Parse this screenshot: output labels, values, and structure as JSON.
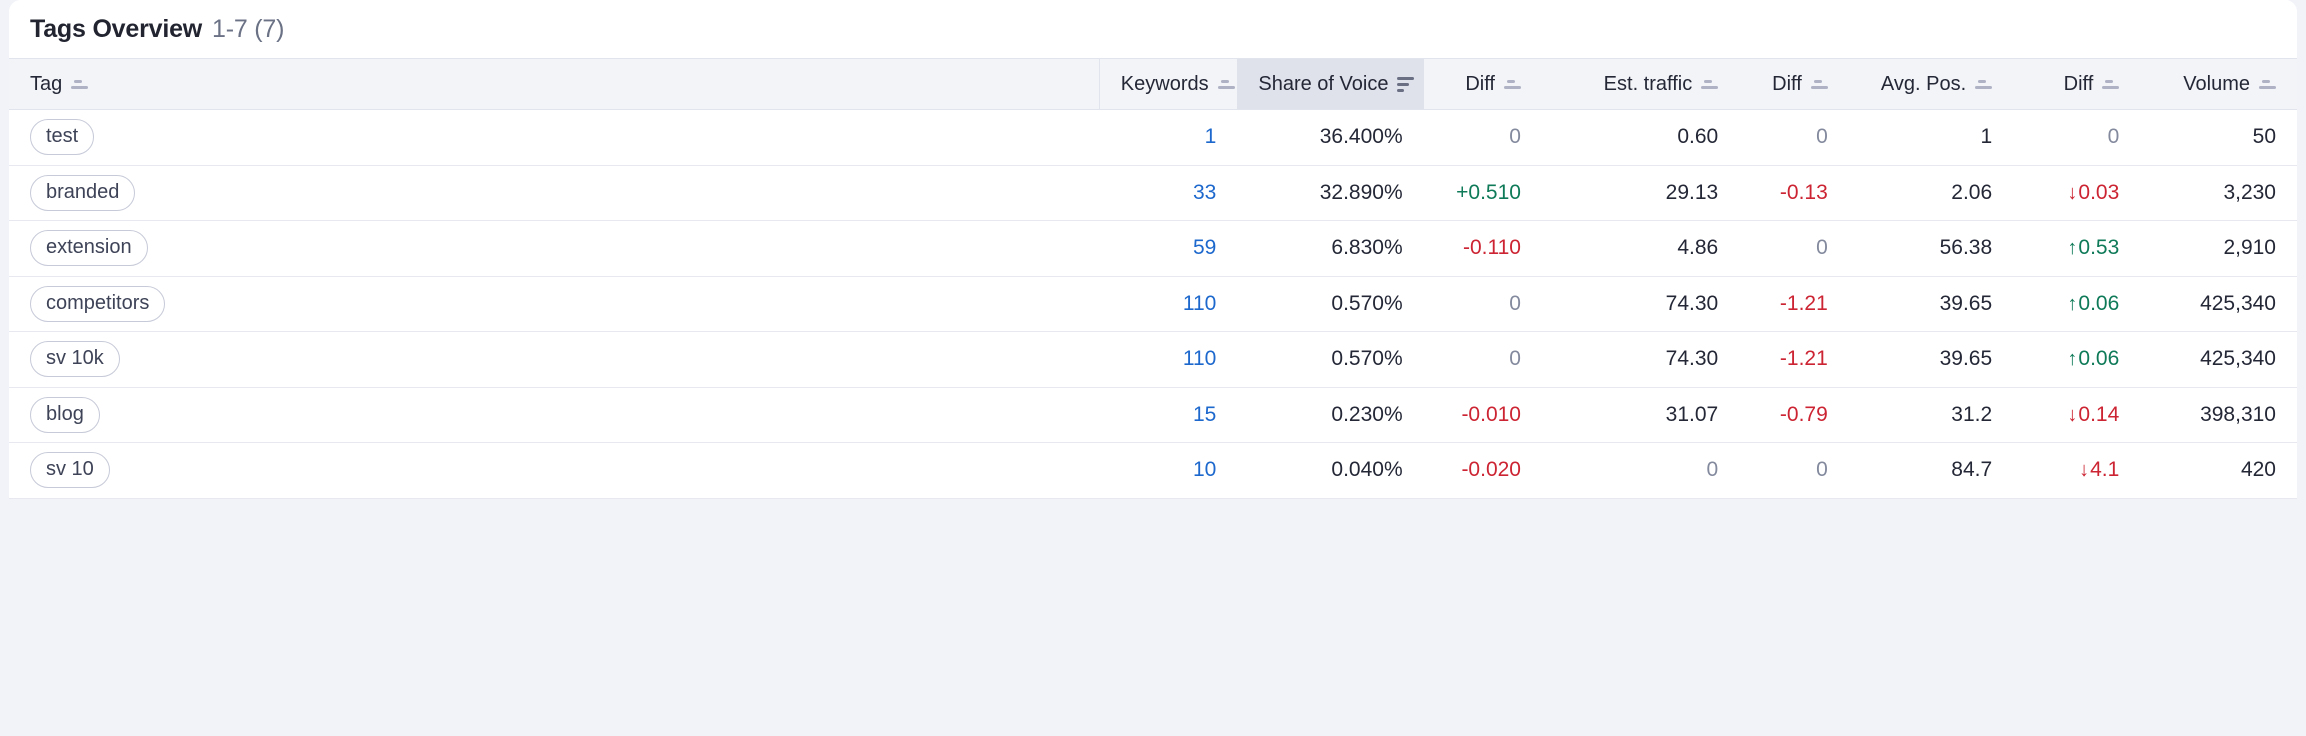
{
  "card": {
    "title": "Tags Overview",
    "count": "1-7 (7)"
  },
  "table": {
    "columns": [
      {
        "label": "Tag",
        "sort": "inactive"
      },
      {
        "label": "Keywords",
        "sort": "inactive"
      },
      {
        "label": "Share of Voice",
        "sort": "active"
      },
      {
        "label": "Diff",
        "sort": "inactive"
      },
      {
        "label": "Est. traffic",
        "sort": "inactive"
      },
      {
        "label": "Diff",
        "sort": "inactive"
      },
      {
        "label": "Avg. Pos.",
        "sort": "inactive"
      },
      {
        "label": "Diff",
        "sort": "inactive"
      },
      {
        "label": "Volume",
        "sort": "inactive"
      }
    ],
    "rows": [
      {
        "tag": "test",
        "keywords": "1",
        "share_of_voice": "36.400%",
        "sov_diff": "0",
        "sov_diff_state": "zero",
        "est_traffic": "0.60",
        "est_traffic_state": "plain",
        "traffic_diff": "0",
        "traffic_diff_state": "zero",
        "avg_pos": "1",
        "avg_pos_state": "plain",
        "pos_diff": "0",
        "pos_diff_state": "zero",
        "pos_diff_arrow": "",
        "volume": "50"
      },
      {
        "tag": "branded",
        "keywords": "33",
        "share_of_voice": "32.890%",
        "sov_diff": "+0.510",
        "sov_diff_state": "pos",
        "est_traffic": "29.13",
        "est_traffic_state": "plain",
        "traffic_diff": "-0.13",
        "traffic_diff_state": "neg",
        "avg_pos": "2.06",
        "avg_pos_state": "plain",
        "pos_diff": "0.03",
        "pos_diff_state": "neg",
        "pos_diff_arrow": "↓",
        "volume": "3,230"
      },
      {
        "tag": "extension",
        "keywords": "59",
        "share_of_voice": "6.830%",
        "sov_diff": "-0.110",
        "sov_diff_state": "neg",
        "est_traffic": "4.86",
        "est_traffic_state": "plain",
        "traffic_diff": "0",
        "traffic_diff_state": "zero",
        "avg_pos": "56.38",
        "avg_pos_state": "plain",
        "pos_diff": "0.53",
        "pos_diff_state": "pos",
        "pos_diff_arrow": "↑",
        "volume": "2,910"
      },
      {
        "tag": "competitors",
        "keywords": "110",
        "share_of_voice": "0.570%",
        "sov_diff": "0",
        "sov_diff_state": "zero",
        "est_traffic": "74.30",
        "est_traffic_state": "plain",
        "traffic_diff": "-1.21",
        "traffic_diff_state": "neg",
        "avg_pos": "39.65",
        "avg_pos_state": "plain",
        "pos_diff": "0.06",
        "pos_diff_state": "pos",
        "pos_diff_arrow": "↑",
        "volume": "425,340"
      },
      {
        "tag": "sv 10k",
        "keywords": "110",
        "share_of_voice": "0.570%",
        "sov_diff": "0",
        "sov_diff_state": "zero",
        "est_traffic": "74.30",
        "est_traffic_state": "plain",
        "traffic_diff": "-1.21",
        "traffic_diff_state": "neg",
        "avg_pos": "39.65",
        "avg_pos_state": "plain",
        "pos_diff": "0.06",
        "pos_diff_state": "pos",
        "pos_diff_arrow": "↑",
        "volume": "425,340"
      },
      {
        "tag": "blog",
        "keywords": "15",
        "share_of_voice": "0.230%",
        "sov_diff": "-0.010",
        "sov_diff_state": "neg",
        "est_traffic": "31.07",
        "est_traffic_state": "plain",
        "traffic_diff": "-0.79",
        "traffic_diff_state": "neg",
        "avg_pos": "31.2",
        "avg_pos_state": "plain",
        "pos_diff": "0.14",
        "pos_diff_state": "neg",
        "pos_diff_arrow": "↓",
        "volume": "398,310"
      },
      {
        "tag": "sv 10",
        "keywords": "10",
        "share_of_voice": "0.040%",
        "sov_diff": "-0.020",
        "sov_diff_state": "neg",
        "est_traffic": "0",
        "est_traffic_state": "zero",
        "traffic_diff": "0",
        "traffic_diff_state": "zero",
        "avg_pos": "84.7",
        "avg_pos_state": "plain",
        "pos_diff": "4.1",
        "pos_diff_state": "neg",
        "pos_diff_arrow": "↓",
        "volume": "420"
      }
    ]
  },
  "colors": {
    "link": "#1d68cd",
    "positive": "#0f7a58",
    "negative": "#cc2432",
    "zero": "#848a9e",
    "page_bg": "#f2f3f8",
    "header_bg": "#f3f4f8",
    "active_header_bg": "#dfe1eb"
  }
}
